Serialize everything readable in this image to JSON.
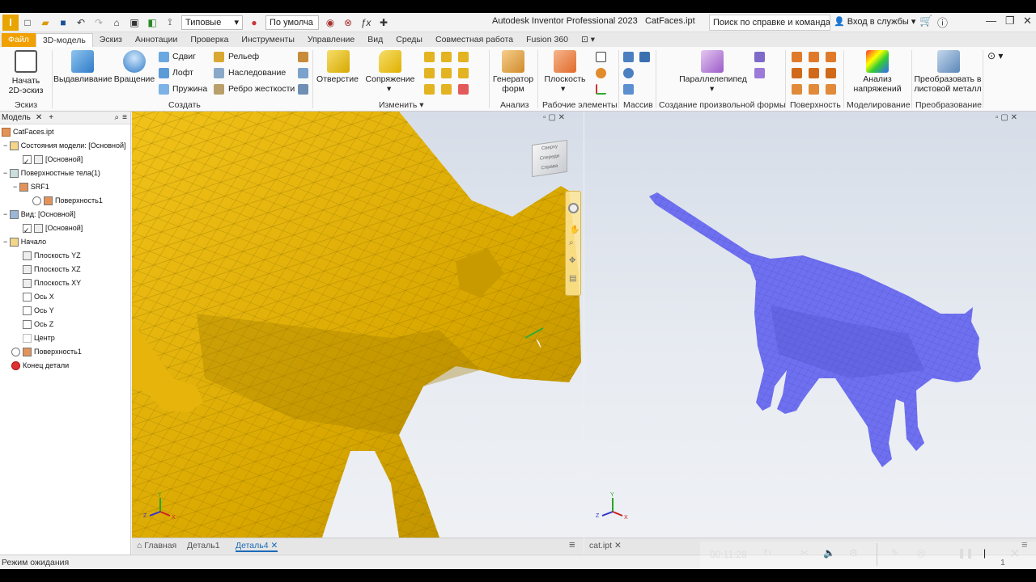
{
  "titlebar": {
    "app_letter": "I",
    "style_combo": "Типовые",
    "appearance_combo": "По умолча",
    "window_title": "Autodesk Inventor Professional 2023",
    "document_name": "CatFaces.ipt",
    "search_placeholder": "Поиск по справке и командам",
    "signin_label": "Вход в службы"
  },
  "tabs": [
    "Файл",
    "3D-модель",
    "Эскиз",
    "Аннотации",
    "Проверка",
    "Инструменты",
    "Управление",
    "Вид",
    "Среды",
    "Совместная работа",
    "Fusion 360"
  ],
  "ribbon": {
    "sketch": {
      "button": "Начать\n2D-эскиз",
      "line1": "Начать",
      "line2": "2D-эскиз",
      "panel": "Эскиз"
    },
    "create": {
      "extrude": "Выдавливание",
      "revolve": "Вращение",
      "sweep": "Сдвиг",
      "loft": "Лофт",
      "coil": "Пружина",
      "emboss": "Рельеф",
      "derive": "Наследование",
      "rib": "Ребро жесткости",
      "panel": "Создать"
    },
    "modify": {
      "hole": "Отверстие",
      "fillet": "Сопряжение",
      "panel": "Изменить"
    },
    "explore": {
      "generator_l1": "Генератор",
      "generator_l2": "форм",
      "panel": "Анализ"
    },
    "work": {
      "plane": "Плоскость",
      "panel": "Рабочие элементы"
    },
    "pattern": {
      "panel": "Массив"
    },
    "freeform": {
      "box": "Параллелепипед",
      "panel": "Создание произвольной формы"
    },
    "surface": {
      "panel": "Поверхность"
    },
    "simulation": {
      "l1": "Анализ",
      "l2": "напряжений",
      "panel": "Моделирование"
    },
    "convert": {
      "l1": "Преобразовать в",
      "l2": "листовой металл",
      "panel": "Преобразование"
    }
  },
  "browser": {
    "title": "Модель",
    "nodes": [
      {
        "label": "CatFaces.ipt"
      },
      {
        "label": "Состояния модели: [Основной]"
      },
      {
        "label": "[Основной]"
      },
      {
        "label": "Поверхностные тела(1)"
      },
      {
        "label": "SRF1"
      },
      {
        "label": "Поверхность1"
      },
      {
        "label": "Вид: [Основной]"
      },
      {
        "label": "[Основной]"
      },
      {
        "label": "Начало"
      },
      {
        "label": "Плоскость YZ"
      },
      {
        "label": "Плоскость XZ"
      },
      {
        "label": "Плоскость XY"
      },
      {
        "label": "Ось X"
      },
      {
        "label": "Ось Y"
      },
      {
        "label": "Ось Z"
      },
      {
        "label": "Центр"
      },
      {
        "label": "Поверхность1"
      },
      {
        "label": "Конец детали"
      }
    ]
  },
  "viewcube": {
    "faces": [
      "Сверху",
      "Спереди",
      "Справа"
    ]
  },
  "doctabs_left": {
    "home": "Главная",
    "tab1": "Деталь1",
    "tab2": "Деталь4"
  },
  "doctabs_right": {
    "tab1": "cat.ipt"
  },
  "status": {
    "text": "Режим ожидания",
    "page": "1"
  },
  "player": {
    "time": "00:11:28"
  },
  "colors": {
    "accent": "#f0a000",
    "left_model": "#e2b005",
    "right_model": "#6f70f0"
  }
}
